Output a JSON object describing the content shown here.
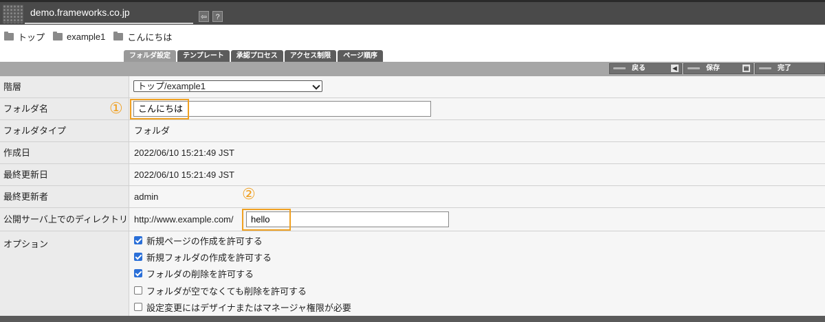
{
  "header": {
    "host": "demo.frameworks.co.jp",
    "buttons": [
      {
        "icon": "exit-icon",
        "glyph": "⇦"
      },
      {
        "icon": "help-icon",
        "glyph": "?"
      }
    ]
  },
  "breadcrumb": [
    "トップ",
    "example1",
    "こんにちは"
  ],
  "tabs": [
    {
      "label": "フォルダ設定",
      "active": true
    },
    {
      "label": "テンプレート",
      "active": false
    },
    {
      "label": "承認プロセス",
      "active": false
    },
    {
      "label": "アクセス制限",
      "active": false
    },
    {
      "label": "ページ順序",
      "active": false
    }
  ],
  "actions": {
    "back_label": "戻る",
    "save_label": "保存",
    "done_label": "完了"
  },
  "form": {
    "hierarchy_label": "階層",
    "hierarchy_value": "トップ/example1",
    "folder_name_label": "フォルダ名",
    "folder_name_value": "こんにちは",
    "folder_type_label": "フォルダタイプ",
    "folder_type_value": "フォルダ",
    "created_label": "作成日",
    "created_value": "2022/06/10 15:21:49 JST",
    "updated_label": "最終更新日",
    "updated_value": "2022/06/10 15:21:49 JST",
    "updater_label": "最終更新者",
    "updater_value": "admin",
    "directory_label": "公開サーバ上でのディレクトリ",
    "directory_prefix": "http://www.example.com/",
    "directory_value": "hello",
    "options_label": "オプション",
    "options": [
      {
        "label": "新規ページの作成を許可する",
        "checked": true
      },
      {
        "label": "新規フォルダの作成を許可する",
        "checked": true
      },
      {
        "label": "フォルダの削除を許可する",
        "checked": true
      },
      {
        "label": "フォルダが空でなくても削除を許可する",
        "checked": false
      },
      {
        "label": "設定変更にはデザイナまたはマネージャ権限が必要",
        "checked": false
      }
    ]
  },
  "annotations": {
    "marker1": "①",
    "marker2": "②",
    "highlight_color": "#f0a020"
  }
}
